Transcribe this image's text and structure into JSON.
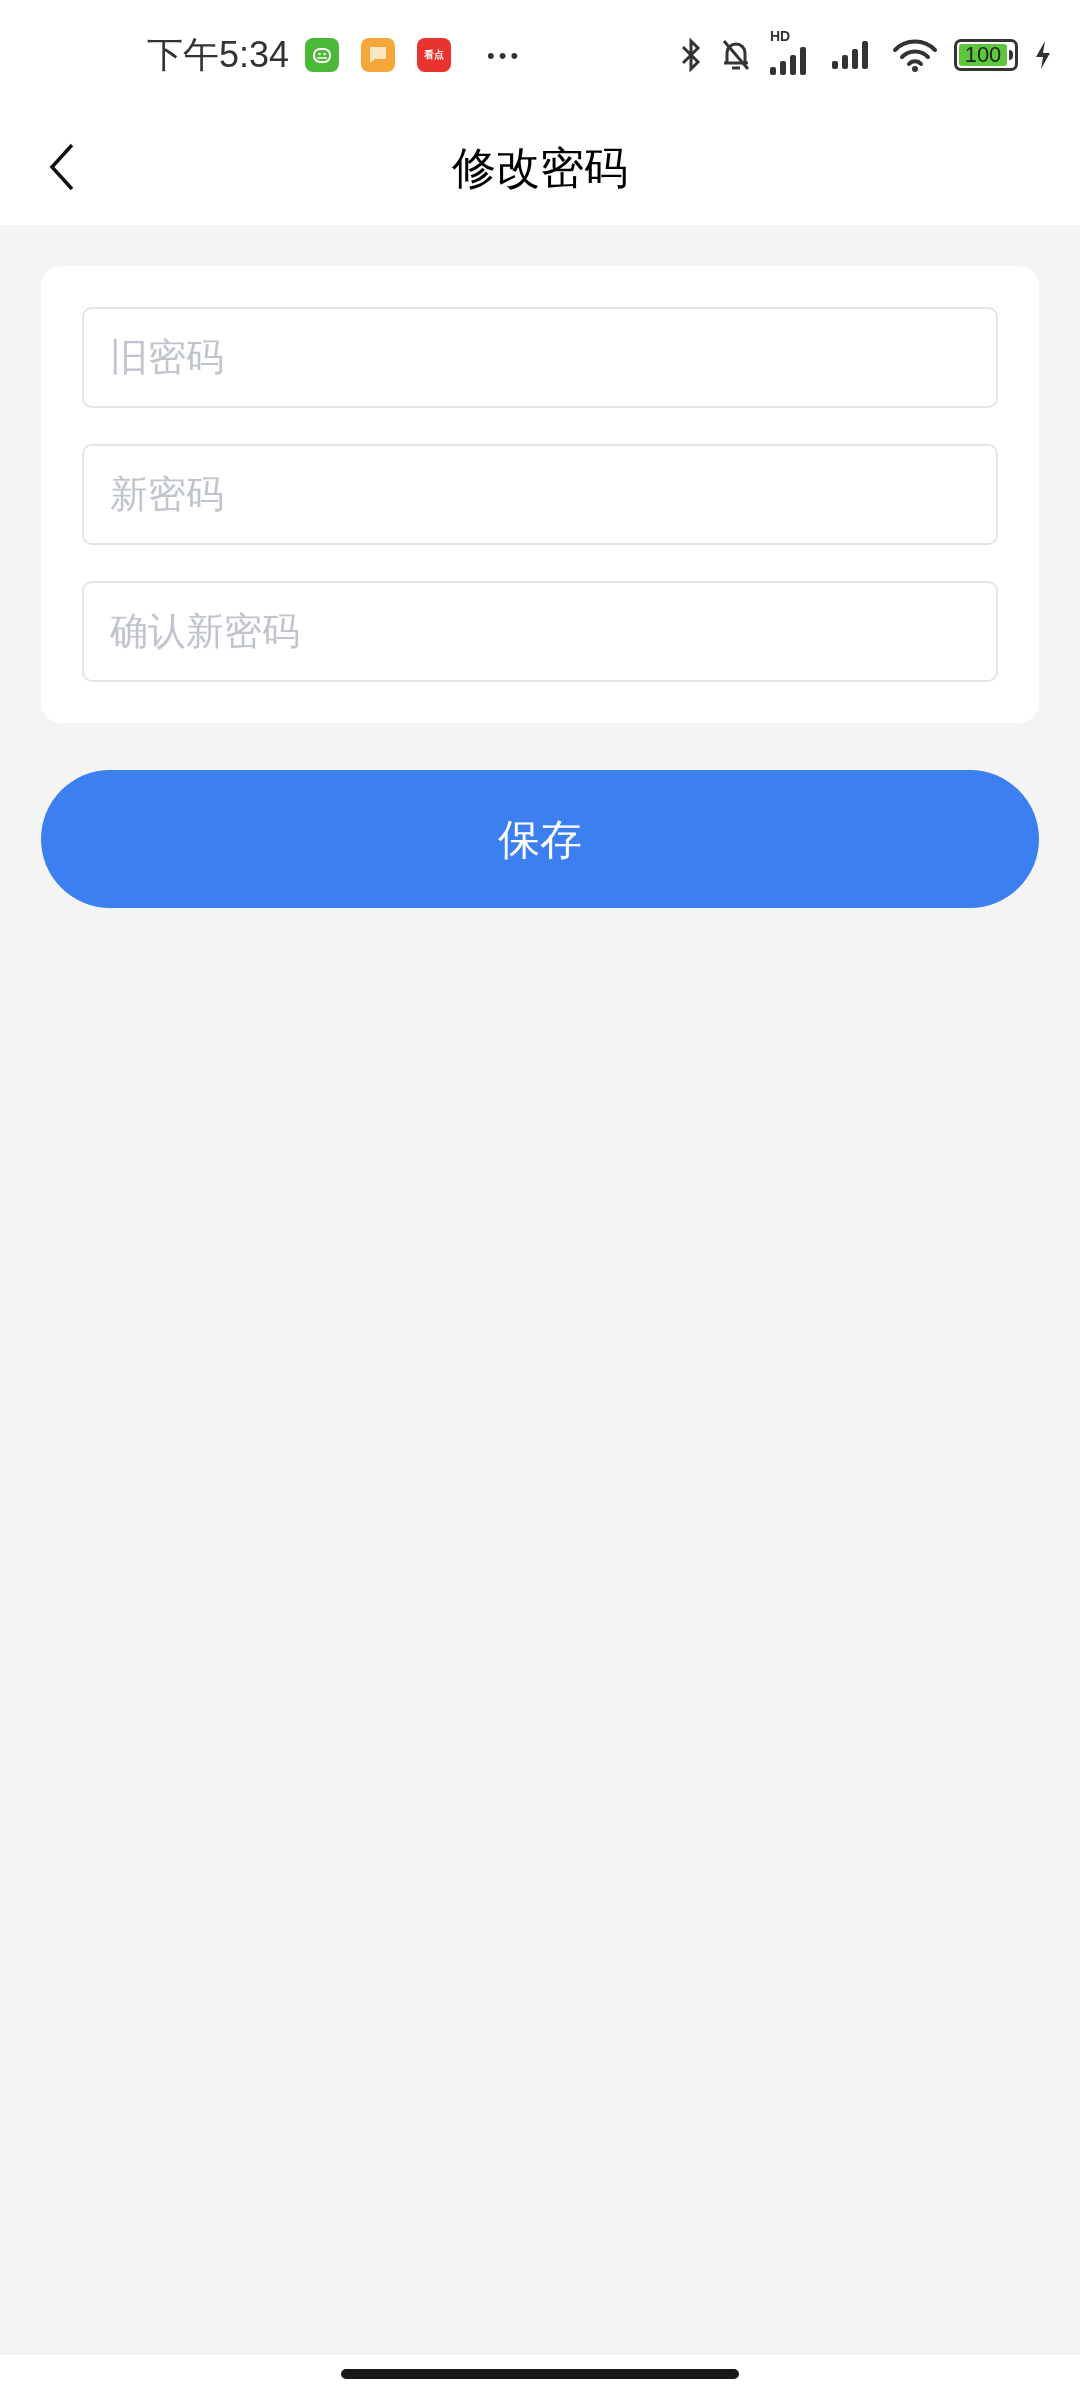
{
  "status_bar": {
    "time": "下午5:34",
    "app_icons": [
      {
        "kind": "green"
      },
      {
        "kind": "orange"
      },
      {
        "kind": "red",
        "label": "看点"
      }
    ],
    "more": "•••",
    "signal_label": "HD",
    "battery": "100"
  },
  "header": {
    "title": "修改密码"
  },
  "form": {
    "fields": [
      {
        "placeholder": "旧密码"
      },
      {
        "placeholder": "新密码"
      },
      {
        "placeholder": "确认新密码"
      }
    ]
  },
  "save_button": "保存"
}
